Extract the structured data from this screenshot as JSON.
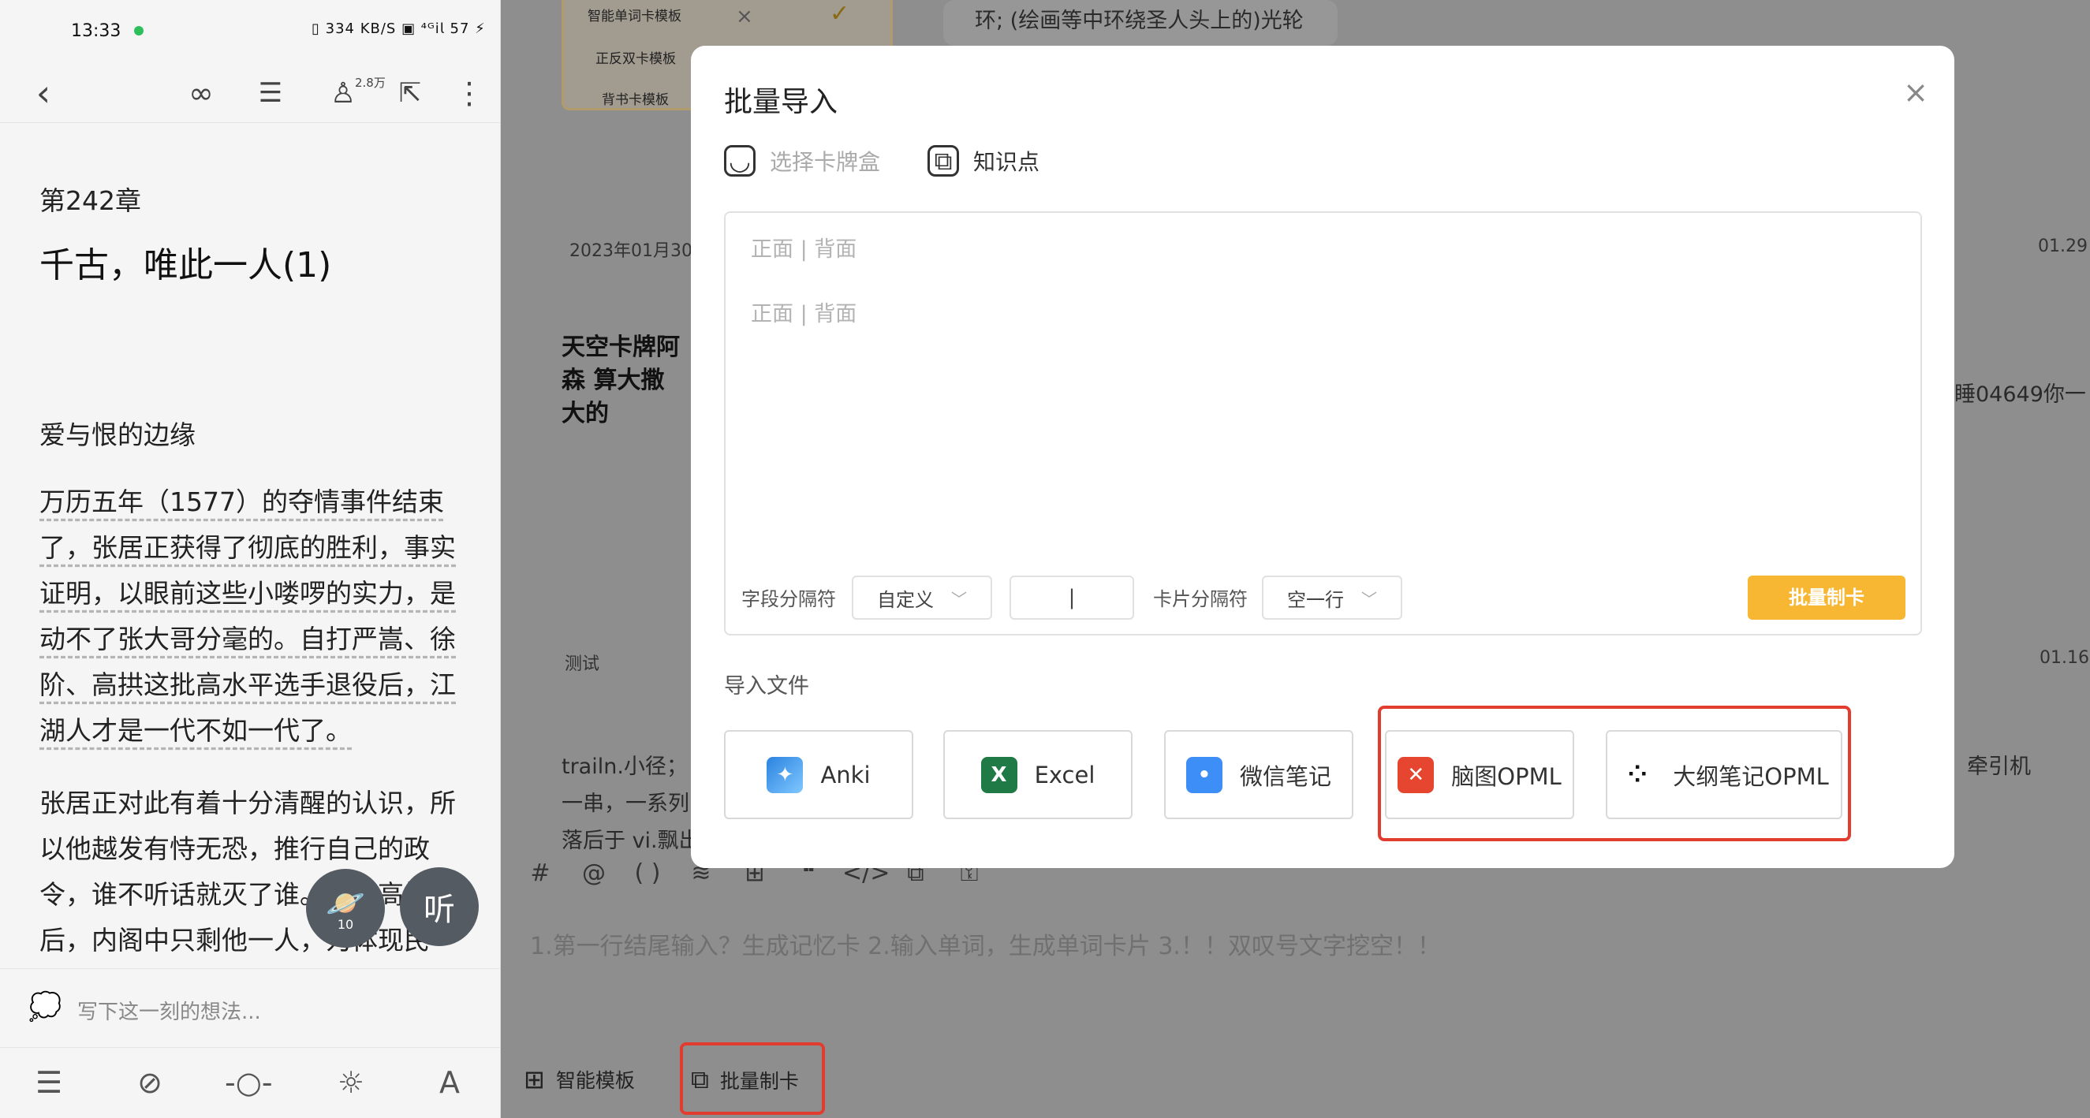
{
  "status_bar": {
    "time": "13:33",
    "indicators": "▯ 334 KB/S ▣ ⁴ᴳ𝗂𝗅 57 ⚡"
  },
  "reader": {
    "toolbar": {
      "back_icon": "chevron-left-icon",
      "user_count": "2.8万"
    },
    "chapter_number": "第242章",
    "chapter_title": "千古，唯此一人(1)",
    "section_heading": "爱与恨的边缘",
    "paragraph1": "万历五年（1577）的夺情事件结束了，张居正获得了彻底的胜利，事实证明，以眼前这些小喽啰的实力，是动不了张大哥分毫的。自打严嵩、徐阶、高拱这批高水平选手退役后，江湖人才是一代不如一代了。",
    "paragraph2": "张居正对此有着十分清醒的认识，所以他越发有恃无恐，推行自己的政令，谁不听话就灭了谁。赶走高拱后，内阁中只剩他一人，为体现民",
    "fab_planet_count": "10",
    "fab_listen_label": "听",
    "thought_placeholder": "写下这一刻的想法..."
  },
  "background": {
    "templates": [
      "智能单词卡模板",
      "正反双卡模板",
      "背书卡模板"
    ],
    "snippet_top": "环; (绘画等中环绕圣人头上的)光轮",
    "date1": "2023年01月30",
    "date1_right": "01.29",
    "card_title": "天空卡牌阿森 算大撒大的",
    "card_right_text": "睡04649你一",
    "meta_test": "测试",
    "date2_right": "01.16",
    "snippet_train": "trailn.小径；",
    "snippet_line2": "一串，一系列",
    "snippet_line3": "落后于 vi.飘出",
    "snippet_right": "牵引机",
    "toolbar_icons": [
      "#",
      "@",
      "( )",
      "≋",
      "⊞",
      "❝",
      "</>",
      "⧉",
      "⚿"
    ],
    "input_hint": "1.第一行结尾输入？生成记忆卡 2.输入单词，生成单词卡片 3.！！双叹号文字挖空！！",
    "bottom_smart_template": "智能模板",
    "bottom_batch_card": "批量制卡"
  },
  "modal": {
    "title": "批量导入",
    "select_deck": "选择卡牌盒",
    "knowledge_point": "知识点",
    "editor_placeholder_1": "正面 | 背面",
    "editor_placeholder_2": "正面 | 背面",
    "field_separator_label": "字段分隔符",
    "field_separator_value": "自定义",
    "field_separator_input": "|",
    "card_separator_label": "卡片分隔符",
    "card_separator_value": "空一行",
    "batch_button": "批量制卡",
    "import_file_label": "导入文件",
    "import_options": [
      {
        "label": "Anki",
        "icon": "anki-icon"
      },
      {
        "label": "Excel",
        "icon": "excel-icon"
      },
      {
        "label": "微信笔记",
        "icon": "wechat-icon"
      },
      {
        "label": "脑图OPML",
        "icon": "mindmap-icon"
      },
      {
        "label": "大纲笔记OPML",
        "icon": "outline-icon"
      }
    ]
  },
  "colors": {
    "accent_yellow": "#f7b733",
    "highlight_red": "#e23c2e"
  }
}
